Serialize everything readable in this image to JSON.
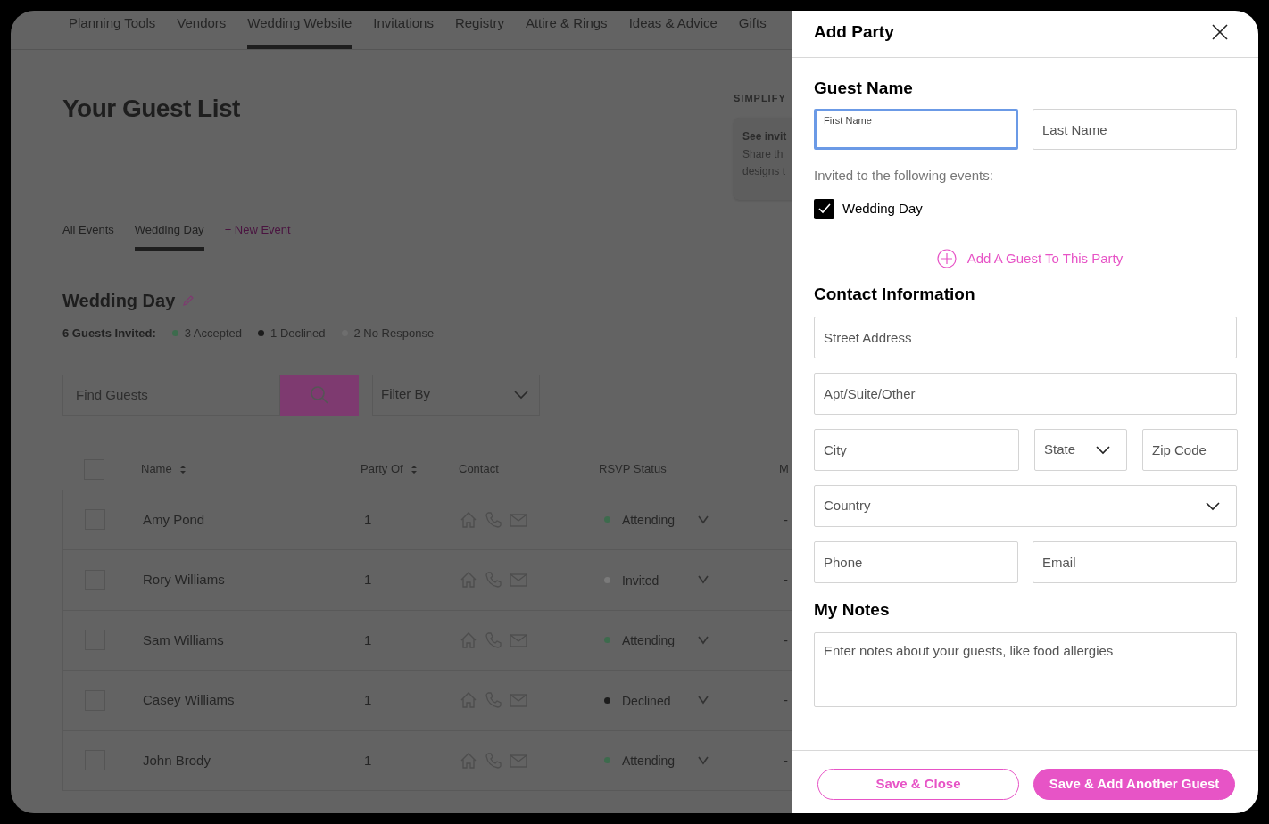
{
  "nav": {
    "items": [
      {
        "label": "Planning Tools",
        "selected": false
      },
      {
        "label": "Vendors",
        "selected": false
      },
      {
        "label": "Wedding Website",
        "selected": true
      },
      {
        "label": "Invitations",
        "selected": false
      },
      {
        "label": "Registry",
        "selected": false
      },
      {
        "label": "Attire & Rings",
        "selected": false
      },
      {
        "label": "Ideas & Advice",
        "selected": false
      },
      {
        "label": "Gifts",
        "selected": false
      }
    ]
  },
  "page": {
    "title": "Your Guest List"
  },
  "promo": {
    "eyebrow": "SIMPLIFY",
    "title": "See invit",
    "lines": [
      "Share th",
      "designs t"
    ]
  },
  "event_tabs": [
    {
      "label": "All Events",
      "kind": "tab",
      "selected": false
    },
    {
      "label": "Wedding Day",
      "kind": "tab",
      "selected": true
    },
    {
      "label": "+ New Event",
      "kind": "add",
      "selected": false
    }
  ],
  "event": {
    "title": "Wedding Day",
    "summary_label": "6 Guests Invited:",
    "counts": [
      {
        "label": "3 Accepted",
        "color": "#3d6b4d"
      },
      {
        "label": "1 Declined",
        "color": "#1c1c1c"
      },
      {
        "label": "2 No Response",
        "color": "#6e6e6e"
      }
    ]
  },
  "search": {
    "placeholder": "Find Guests"
  },
  "filter": {
    "value": "Filter By"
  },
  "table": {
    "columns": [
      {
        "label": "Name",
        "sortable": true
      },
      {
        "label": "Party Of",
        "sortable": true
      },
      {
        "label": "Contact",
        "sortable": false
      },
      {
        "label": "RSVP Status",
        "sortable": false
      },
      {
        "label": "M"
      }
    ],
    "select_all_checked": false,
    "rows": [
      {
        "name": "Amy Pond",
        "party_of": "1",
        "status": "Attending",
        "color": "#3d6b4d",
        "checked": false,
        "column_5": "-"
      },
      {
        "name": "Rory Williams",
        "party_of": "1",
        "status": "Invited",
        "color": "#7a7a7a",
        "checked": false,
        "column_5": "-"
      },
      {
        "name": "Sam Williams",
        "party_of": "1",
        "status": "Attending",
        "color": "#3d6b4d",
        "checked": false,
        "column_5": "-"
      },
      {
        "name": "Casey Williams",
        "party_of": "1",
        "status": "Declined",
        "color": "#1c1c1c",
        "checked": false,
        "column_5": "-"
      },
      {
        "name": "John Brody",
        "party_of": "1",
        "status": "Attending",
        "color": "#3d6b4d",
        "checked": false,
        "column_5": "-"
      }
    ]
  },
  "panel": {
    "title": "Add Party",
    "guest_name": {
      "heading": "Guest Name",
      "fields": [
        {
          "label": "First Name",
          "focused": true
        },
        {
          "placeholder": "Last Name",
          "focused": false
        }
      ]
    },
    "events": {
      "label": "Invited to the following events:",
      "options": [
        {
          "label": "Wedding Day",
          "checked": true
        }
      ]
    },
    "add_guest_link": "Add A Guest To This Party",
    "contact": {
      "heading": "Contact Information",
      "rows": [
        [
          {
            "kind": "text",
            "placeholder": "Street Address"
          }
        ],
        [
          {
            "kind": "text",
            "placeholder": "Apt/Suite/Other"
          }
        ],
        [
          {
            "kind": "text",
            "placeholder": "City"
          },
          {
            "kind": "select",
            "placeholder": "State"
          },
          {
            "kind": "text",
            "placeholder": "Zip Code"
          }
        ],
        [
          {
            "kind": "select",
            "placeholder": "Country"
          }
        ],
        [
          {
            "kind": "text",
            "placeholder": "Phone"
          },
          {
            "kind": "text",
            "placeholder": "Email"
          }
        ]
      ]
    },
    "notes": {
      "heading": "My Notes",
      "placeholder": "Enter notes about your guests, like food allergies"
    },
    "buttons": [
      {
        "label": "Save & Close",
        "kind": "secondary"
      },
      {
        "label": "Save & Add Another Guest",
        "kind": "primary"
      }
    ]
  }
}
